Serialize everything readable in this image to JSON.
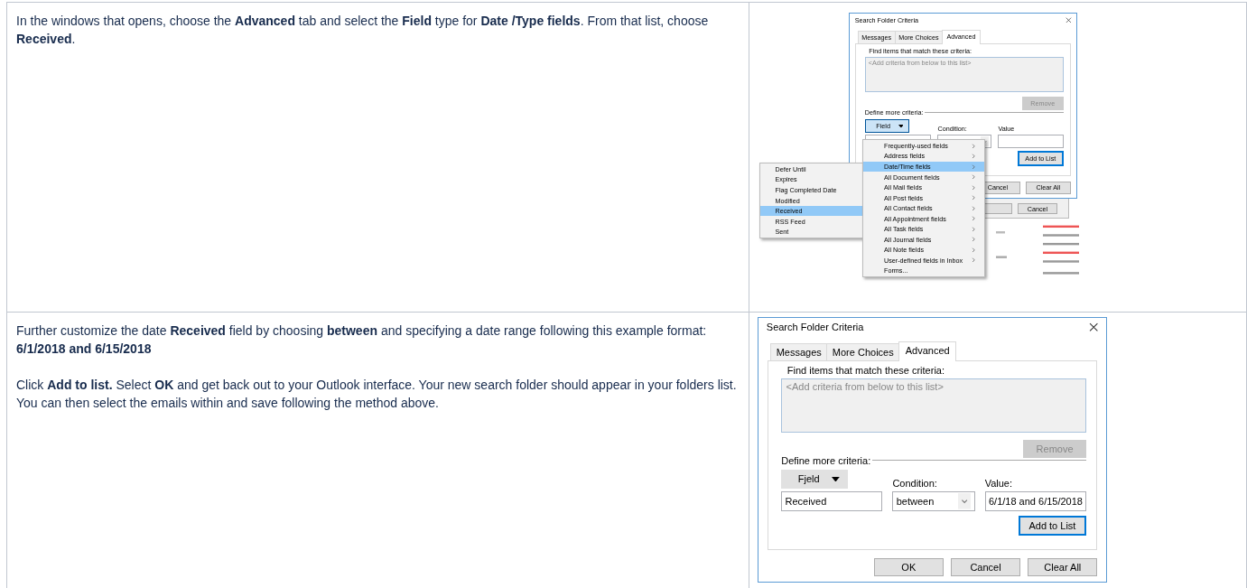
{
  "steps": [
    {
      "text": [
        "In the windows that opens, choose the **Advanced** tab and select the **Field** type for **Date /Type fields**. From that list, choose **Received**."
      ],
      "screenshot": {
        "kind": "menus",
        "dialog": {
          "title": "Search Folder Criteria",
          "tabs": [
            {
              "label": "Messages",
              "selected": false
            },
            {
              "label": "More Choices",
              "selected": false
            },
            {
              "label": "Advanced",
              "selected": true
            }
          ],
          "criteria_label": "Find items that match these criteria:",
          "criteria_placeholder": "<Add criteria from below to this list>",
          "remove_button": {
            "label": "Remove",
            "disabled": true
          },
          "define_label": "Define more criteria:",
          "field_button": {
            "label": "Field",
            "pressed": true
          },
          "condition_label": "Condition:",
          "value_label": "Value",
          "add_button": "Add to List",
          "buttons": [
            "Cancel",
            "Clear All"
          ]
        },
        "background_window": {
          "buttons": [
            "Cancel"
          ]
        },
        "field_menu": {
          "items": [
            {
              "label": "Frequently-used fields",
              "submenu": true,
              "selected": false
            },
            {
              "label": "Address fields",
              "submenu": true,
              "selected": false
            },
            {
              "label": "Date/Time fields",
              "submenu": true,
              "selected": true
            },
            {
              "label": "All Document fields",
              "submenu": true,
              "selected": false
            },
            {
              "label": "All Mail fields",
              "submenu": true,
              "selected": false
            },
            {
              "label": "All Post fields",
              "submenu": true,
              "selected": false
            },
            {
              "label": "All Contact fields",
              "submenu": true,
              "selected": false
            },
            {
              "label": "All Appointment fields",
              "submenu": true,
              "selected": false
            },
            {
              "label": "All Task fields",
              "submenu": true,
              "selected": false
            },
            {
              "label": "All Journal fields",
              "submenu": true,
              "selected": false
            },
            {
              "label": "All Note fields",
              "submenu": true,
              "selected": false
            },
            {
              "label": "User-defined fields in Inbox",
              "submenu": true,
              "selected": false
            },
            {
              "label": "Forms...",
              "submenu": false,
              "selected": false
            }
          ]
        },
        "date_menu": {
          "items": [
            {
              "label": "Defer Until",
              "selected": false
            },
            {
              "label": "Expires",
              "selected": false
            },
            {
              "label": "Flag Completed Date",
              "selected": false
            },
            {
              "label": "Modified",
              "selected": false
            },
            {
              "label": "Received",
              "selected": true
            },
            {
              "label": "RSS Feed",
              "selected": false
            },
            {
              "label": "Sent",
              "selected": false
            }
          ]
        }
      }
    },
    {
      "text": [
        "Further customize the date **Received** field by choosing **between** and specifying a date range following this example format: **6/1/2018 and 6/15/2018**",
        "Click **Add to list.** Select **OK** and get back out to your Outlook interface. Your new search folder should appear in your folders list. You can then select the emails within and save following the method above."
      ],
      "screenshot": {
        "kind": "dialog",
        "dialog": {
          "title": "Search Folder Criteria",
          "tabs": [
            {
              "label": "Messages",
              "selected": false
            },
            {
              "label": "More Choices",
              "selected": false
            },
            {
              "label": "Advanced",
              "selected": true
            }
          ],
          "criteria_label": "Find items that match these criteria:",
          "criteria_placeholder": "<Add criteria from below to this list>",
          "remove_button": {
            "label": "Remove",
            "disabled": true
          },
          "define_label": "Define more criteria:",
          "field_button": {
            "label": "Fjeld",
            "pressed": false
          },
          "condition_label": "Condition:",
          "value_label": "Value:",
          "field_value": "Received",
          "condition_value": "between",
          "value_value": "6/1/18 and 6/15/2018",
          "add_button": "Add to List",
          "buttons": [
            "OK",
            "Cancel",
            "Clear All"
          ]
        }
      }
    }
  ]
}
